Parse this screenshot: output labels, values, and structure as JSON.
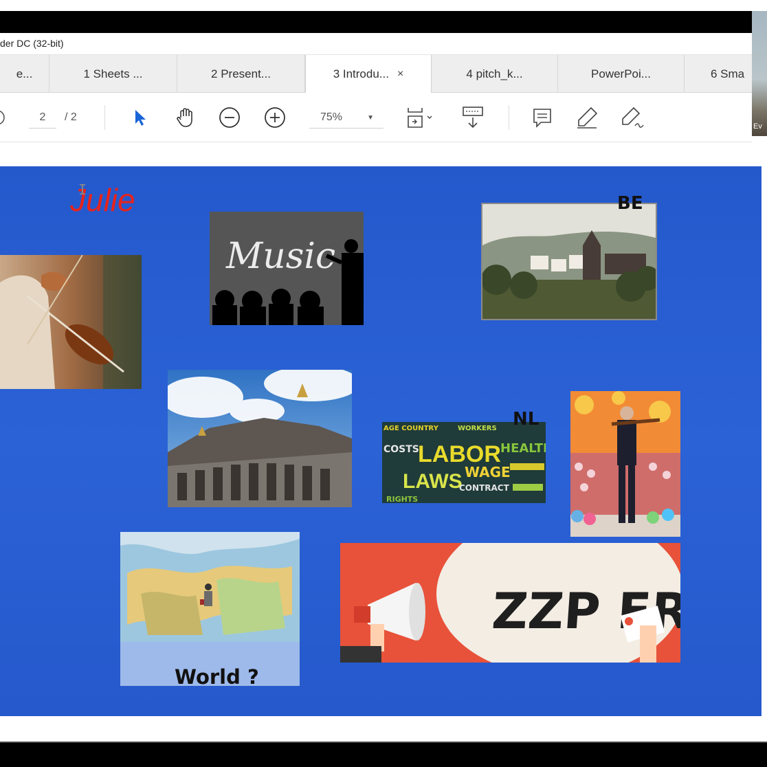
{
  "window": {
    "title": "der DC (32-bit)"
  },
  "tabs": [
    {
      "label": "e..."
    },
    {
      "label": "1 Sheets ..."
    },
    {
      "label": "2 Present..."
    },
    {
      "label": "3 Introdu...",
      "close": "×"
    },
    {
      "label": "4 pitch_k..."
    },
    {
      "label": "PowerPoi..."
    },
    {
      "label": "6 Sma"
    }
  ],
  "toolbar": {
    "page_current": "2",
    "page_total": "/ 2",
    "zoom": "75%",
    "icons": [
      "prev-page-icon",
      "select-arrow-icon",
      "hand-tool-icon",
      "zoom-out-icon",
      "zoom-in-icon",
      "fit-page-icon",
      "scroll-mode-icon",
      "comment-icon",
      "highlight-pen-icon",
      "sign-icon"
    ]
  },
  "webcam": {
    "label": "Ev"
  },
  "slide": {
    "title": "Julie",
    "labels": {
      "be": "BE",
      "nl": "NL",
      "world": "World ?"
    },
    "image_texts": {
      "music": "Music",
      "labor_big": "LABOR",
      "laws": "LAWS",
      "wage": "WAGE",
      "health": "HEALTH",
      "costs": "COSTS",
      "contract": "CONTRACT",
      "workers": "WORKERS",
      "rights": "RIGHTS",
      "zzp": "ZZP ER"
    },
    "background_color": "#2a5fd3"
  }
}
